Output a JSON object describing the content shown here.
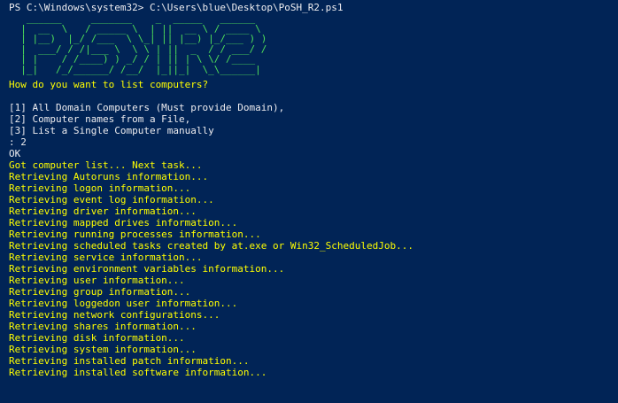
{
  "colors": {
    "background": "#012456",
    "default_text": "#eeedf0",
    "info_text": "#ffff00",
    "banner_text": "#4fe05a"
  },
  "prompt": {
    "text": "PS C:\\Windows\\system32> C:\\Users\\blue\\Desktop\\PoSH_R2.ps1"
  },
  "banner": {
    "lines": [
      "   ______     _______    _  _____   ______",
      "  |  __  \\   / _____ \\  | ||  __ \\ / ____ \\",
      "  | |__)  |_/ /___  \\ \\_| || |__) |_/___ ) )",
      "  |  ___/ / /|___ \\  \\ \\ | ||  _  / / ___/ /",
      "  | |    / /____) ) _/ / | || | \\ \\/ /____",
      "  |_|   /_/______/ /__/  |_||_|  \\_\\______|"
    ]
  },
  "question": "How do you want to list computers?",
  "options": [
    "[1] All Domain Computers (Must provide Domain),",
    "[2] Computer names from a File,",
    "[3] List a Single Computer manually"
  ],
  "input_line": ": 2",
  "ok_line": "OK",
  "log": [
    "Got computer list... Next task...",
    "Retrieving Autoruns information...",
    "Retrieving logon information...",
    "Retrieving event log information...",
    "Retrieving driver information...",
    "Retrieving mapped drives information...",
    "Retrieving running processes information...",
    "Retrieving scheduled tasks created by at.exe or Win32_ScheduledJob...",
    "Retrieving service information...",
    "Retrieving environment variables information...",
    "Retrieving user information...",
    "Retrieving group information...",
    "Retrieving loggedon user information...",
    "Retrieving network configurations...",
    "Retrieving shares information...",
    "Retrieving disk information...",
    "Retrieving system information...",
    "Retrieving installed patch information...",
    "Retrieving installed software information..."
  ]
}
